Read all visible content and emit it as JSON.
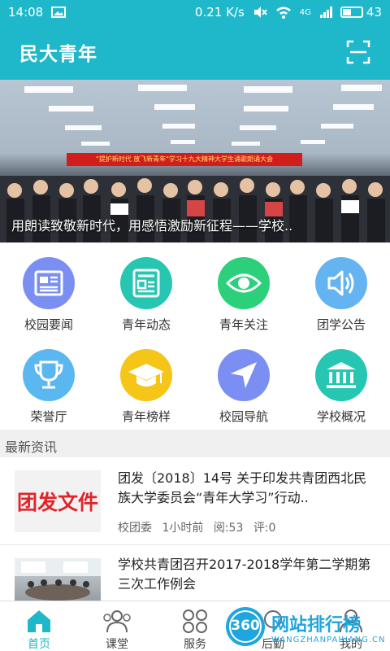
{
  "status_bar": {
    "time": "14:08",
    "network": "0.21 K/s",
    "signal": "4G",
    "battery": "43",
    "battery_level": 0.43
  },
  "app": {
    "title": "民大青年",
    "scan_icon": "scan-icon"
  },
  "banner": {
    "sign_text": "\"提护新时代 放飞新青年\"学习十九大精神大学生诵歌朗诵大会",
    "caption": "用朗读致敬新时代，用感悟激励新征程——学校.."
  },
  "grid": [
    {
      "label": "校园要闻",
      "icon": "news-icon",
      "color": "#7b8ff2"
    },
    {
      "label": "青年动态",
      "icon": "newspaper-icon",
      "color": "#26c6b2"
    },
    {
      "label": "青年关注",
      "icon": "eye-icon",
      "color": "#2ccf7a"
    },
    {
      "label": "团学公告",
      "icon": "speaker-icon",
      "color": "#63b4f0"
    },
    {
      "label": "荣誉厅",
      "icon": "trophy-icon",
      "color": "#5bb7f0"
    },
    {
      "label": "青年榜样",
      "icon": "graduation-cap-icon",
      "color": "#f5c518"
    },
    {
      "label": "校园导航",
      "icon": "navigation-icon",
      "color": "#7b8ff2"
    },
    {
      "label": "学校概况",
      "icon": "building-icon",
      "color": "#26c6b2"
    }
  ],
  "news": {
    "section_title": "最新资讯",
    "items": [
      {
        "thumb_text": "团发文件",
        "title": "团发〔2018〕14号 关于印发共青团西北民族大学委员会“青年大学习”行动..",
        "source": "校团委",
        "time": "1小时前",
        "views": "阅:53",
        "comments": "评:0"
      },
      {
        "title": "学校共青团召开2017-2018学年第二学期第三次工作例会"
      }
    ]
  },
  "tabs": [
    {
      "label": "首页",
      "icon": "home-icon",
      "active": true
    },
    {
      "label": "课堂",
      "icon": "people-icon",
      "active": false
    },
    {
      "label": "服务",
      "icon": "grid-icon",
      "active": false
    },
    {
      "label": "后勤",
      "icon": "support-icon",
      "active": false
    },
    {
      "label": "我的",
      "icon": "user-icon",
      "active": false
    }
  ],
  "watermark": {
    "badge": "360",
    "text": "网站排行榜",
    "sub": "WANGZHANPAIHANG.CN"
  },
  "colors": {
    "primary": "#1fb8ca",
    "text": "#222222"
  }
}
